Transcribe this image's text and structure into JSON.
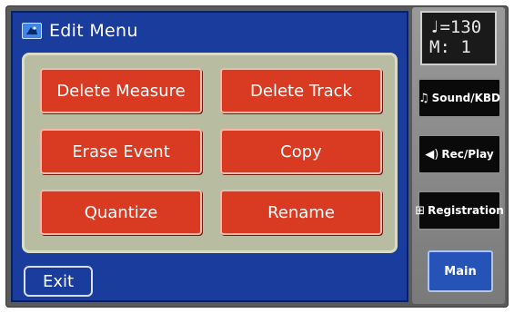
{
  "header": {
    "title": "Edit Menu",
    "icon": "edit-menu-icon"
  },
  "menu": {
    "buttons": [
      {
        "label": "Delete Measure"
      },
      {
        "label": "Delete Track"
      },
      {
        "label": "Erase Event"
      },
      {
        "label": "Copy"
      },
      {
        "label": "Quantize"
      },
      {
        "label": "Rename"
      }
    ]
  },
  "footer": {
    "exit_label": "Exit"
  },
  "display": {
    "tempo": "♩=130",
    "measure": "M:  1"
  },
  "sidebar": {
    "buttons": [
      {
        "label": "Sound/KBD",
        "icon": "music-note-icon"
      },
      {
        "label": "Rec/Play",
        "icon": "speaker-icon"
      },
      {
        "label": "Registration",
        "icon": "book-icon"
      }
    ],
    "main_label": "Main"
  },
  "colors": {
    "screen_background": "#1a3c9c",
    "menu_button": "#d93a22",
    "panel": "#b8bca0",
    "main_button": "#2653b8"
  }
}
